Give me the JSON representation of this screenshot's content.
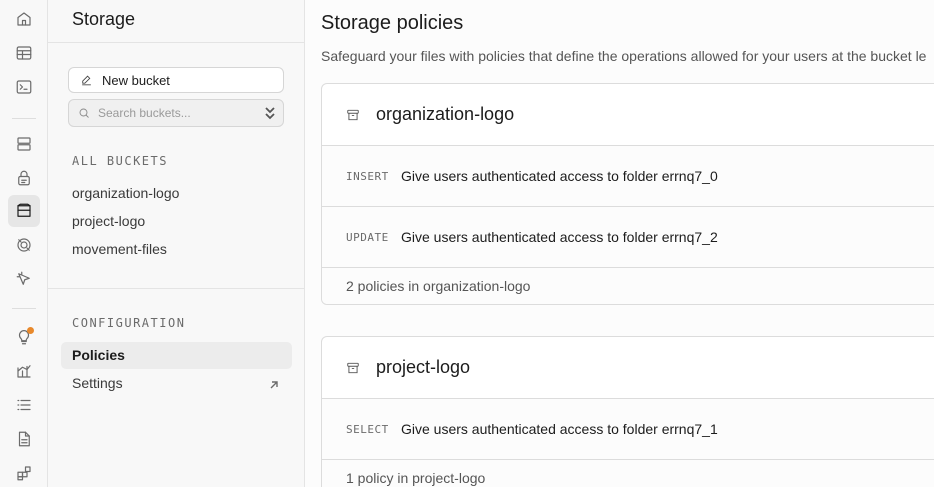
{
  "rail": {
    "icons": [
      "home-icon",
      "table-editor-icon",
      "sql-editor-icon",
      "database-icon",
      "auth-icon",
      "storage-icon",
      "realtime-icon",
      "edge-functions-icon",
      "advisors-icon",
      "reports-icon",
      "logs-icon",
      "api-docs-icon",
      "integrations-icon"
    ],
    "active": "storage-icon",
    "notification_color": "#e8892c"
  },
  "sidebar": {
    "title": "Storage",
    "new_bucket_label": "New bucket",
    "search_placeholder": "Search buckets...",
    "all_buckets_label": "ALL BUCKETS",
    "buckets": [
      "organization-logo",
      "project-logo",
      "movement-files"
    ],
    "configuration_label": "CONFIGURATION",
    "config_items": [
      {
        "label": "Policies",
        "active": true
      },
      {
        "label": "Settings",
        "active": false,
        "external": true
      }
    ]
  },
  "main": {
    "title": "Storage policies",
    "description": "Safeguard your files with policies that define the operations allowed for your users at the bucket le",
    "buckets": [
      {
        "name": "organization-logo",
        "policies": [
          {
            "operation": "INSERT",
            "name": "Give users authenticated access to folder errnq7_0"
          },
          {
            "operation": "UPDATE",
            "name": "Give users authenticated access to folder errnq7_2"
          }
        ],
        "footer": "2 policies in organization-logo"
      },
      {
        "name": "project-logo",
        "policies": [
          {
            "operation": "SELECT",
            "name": "Give users authenticated access to folder errnq7_1"
          }
        ],
        "footer": "1 policy in project-logo"
      }
    ]
  }
}
